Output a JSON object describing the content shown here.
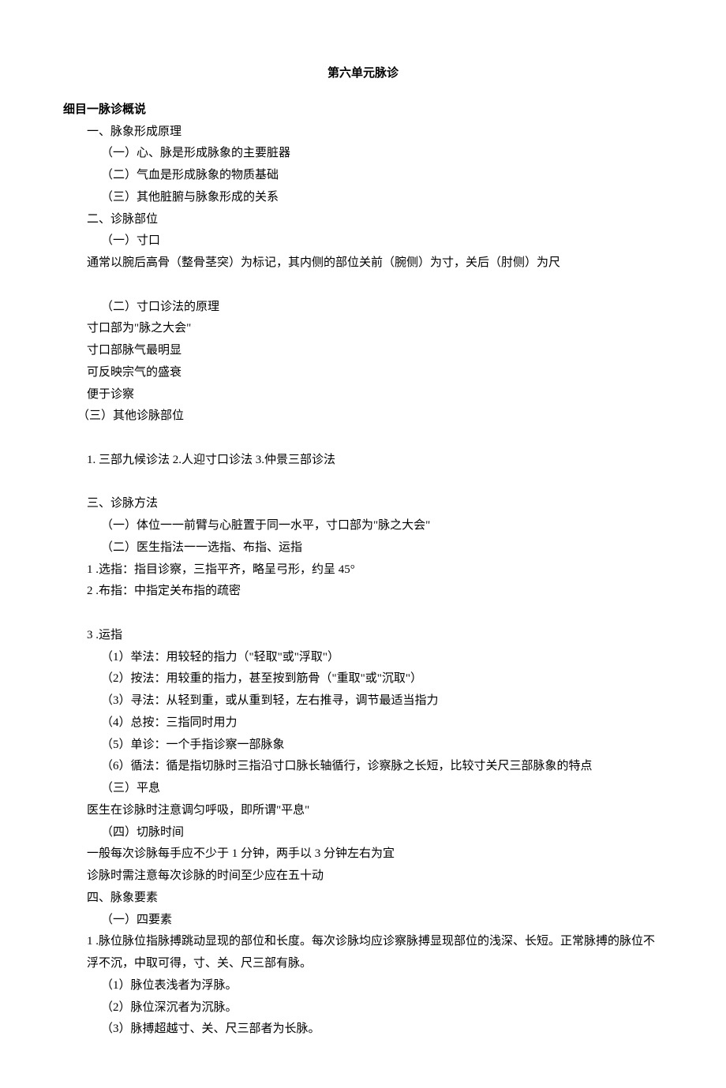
{
  "title": "第六单元脉诊",
  "section1_heading": "细目一脉诊概说",
  "s1_1": "一、脉象形成原理",
  "s1_1_1": "（一）心、脉是形成脉象的主要脏器",
  "s1_1_2": "（二）气血是形成脉象的物质基础",
  "s1_1_3": "（三）其他脏腑与脉象形成的关系",
  "s1_2": "二、诊脉部位",
  "s1_2_1": "（一）寸口",
  "s1_2_1_text": "通常以腕后高骨（整骨茎突）为标记，其内侧的部位关前（腕侧）为寸，关后（肘侧）为尺",
  "s1_2_2": "（二）寸口诊法的原理",
  "s1_2_2_a": "寸口部为\"脉之大会\"",
  "s1_2_2_b": "寸口部脉气最明显",
  "s1_2_2_c": "可反映宗气的盛衰",
  "s1_2_2_d": "便于诊察",
  "s1_2_3": "（三）其他诊脉部位",
  "s1_2_3_text": "1. 三部九候诊法 2.人迎寸口诊法 3.仲景三部诊法",
  "s1_3": "三、诊脉方法",
  "s1_3_1": "（一）体位一一前臂与心脏置于同一水平，寸口部为\"脉之大会\"",
  "s1_3_2": "（二）医生指法一一选指、布指、运指",
  "s1_3_2_1": "1 .选指：指目诊察，三指平齐，略呈弓形，约呈 45°",
  "s1_3_2_2": "2 .布指：中指定关布指的疏密",
  "s1_3_2_3": "3 .运指",
  "s1_3_2_3_1": "（1）举法：用较轻的指力（\"轻取\"或\"浮取\"）",
  "s1_3_2_3_2": "（2）按法：用较重的指力，甚至按到筋骨（\"重取\"或\"沉取\"）",
  "s1_3_2_3_3": "（3）寻法：从轻到重，或从重到轻，左右推寻，调节最适当指力",
  "s1_3_2_3_4": "（4）总按：三指同时用力",
  "s1_3_2_3_5": "（5）单诊：一个手指诊察一部脉象",
  "s1_3_2_3_6": "（6）循法：循是指切脉时三指沿寸口脉长轴循行，诊察脉之长短，比较寸关尺三部脉象的特点",
  "s1_3_3": "（三）平息",
  "s1_3_3_text": "医生在诊脉时注意调匀呼吸，即所谓\"平息\"",
  "s1_3_4": "（四）切脉时间",
  "s1_3_4_a": "一般每次诊脉每手应不少于 1 分钟，两手以 3 分钟左右为宜",
  "s1_3_4_b": "诊脉时需注意每次诊脉的时间至少应在五十动",
  "s1_4": "四、脉象要素",
  "s1_4_1": "（一）四要素",
  "s1_4_1_1": "1 .脉位脉位指脉搏跳动显现的部位和长度。每次诊脉均应诊察脉搏显现部位的浅深、长短。正常脉搏的脉位不浮不沉，中取可得，寸、关、尺三部有脉。",
  "s1_4_1_1_a": "（1）脉位表浅者为浮脉。",
  "s1_4_1_1_b": "（2）脉位深沉者为沉脉。",
  "s1_4_1_1_c": "（3）脉搏超越寸、关、尺三部者为长脉。"
}
